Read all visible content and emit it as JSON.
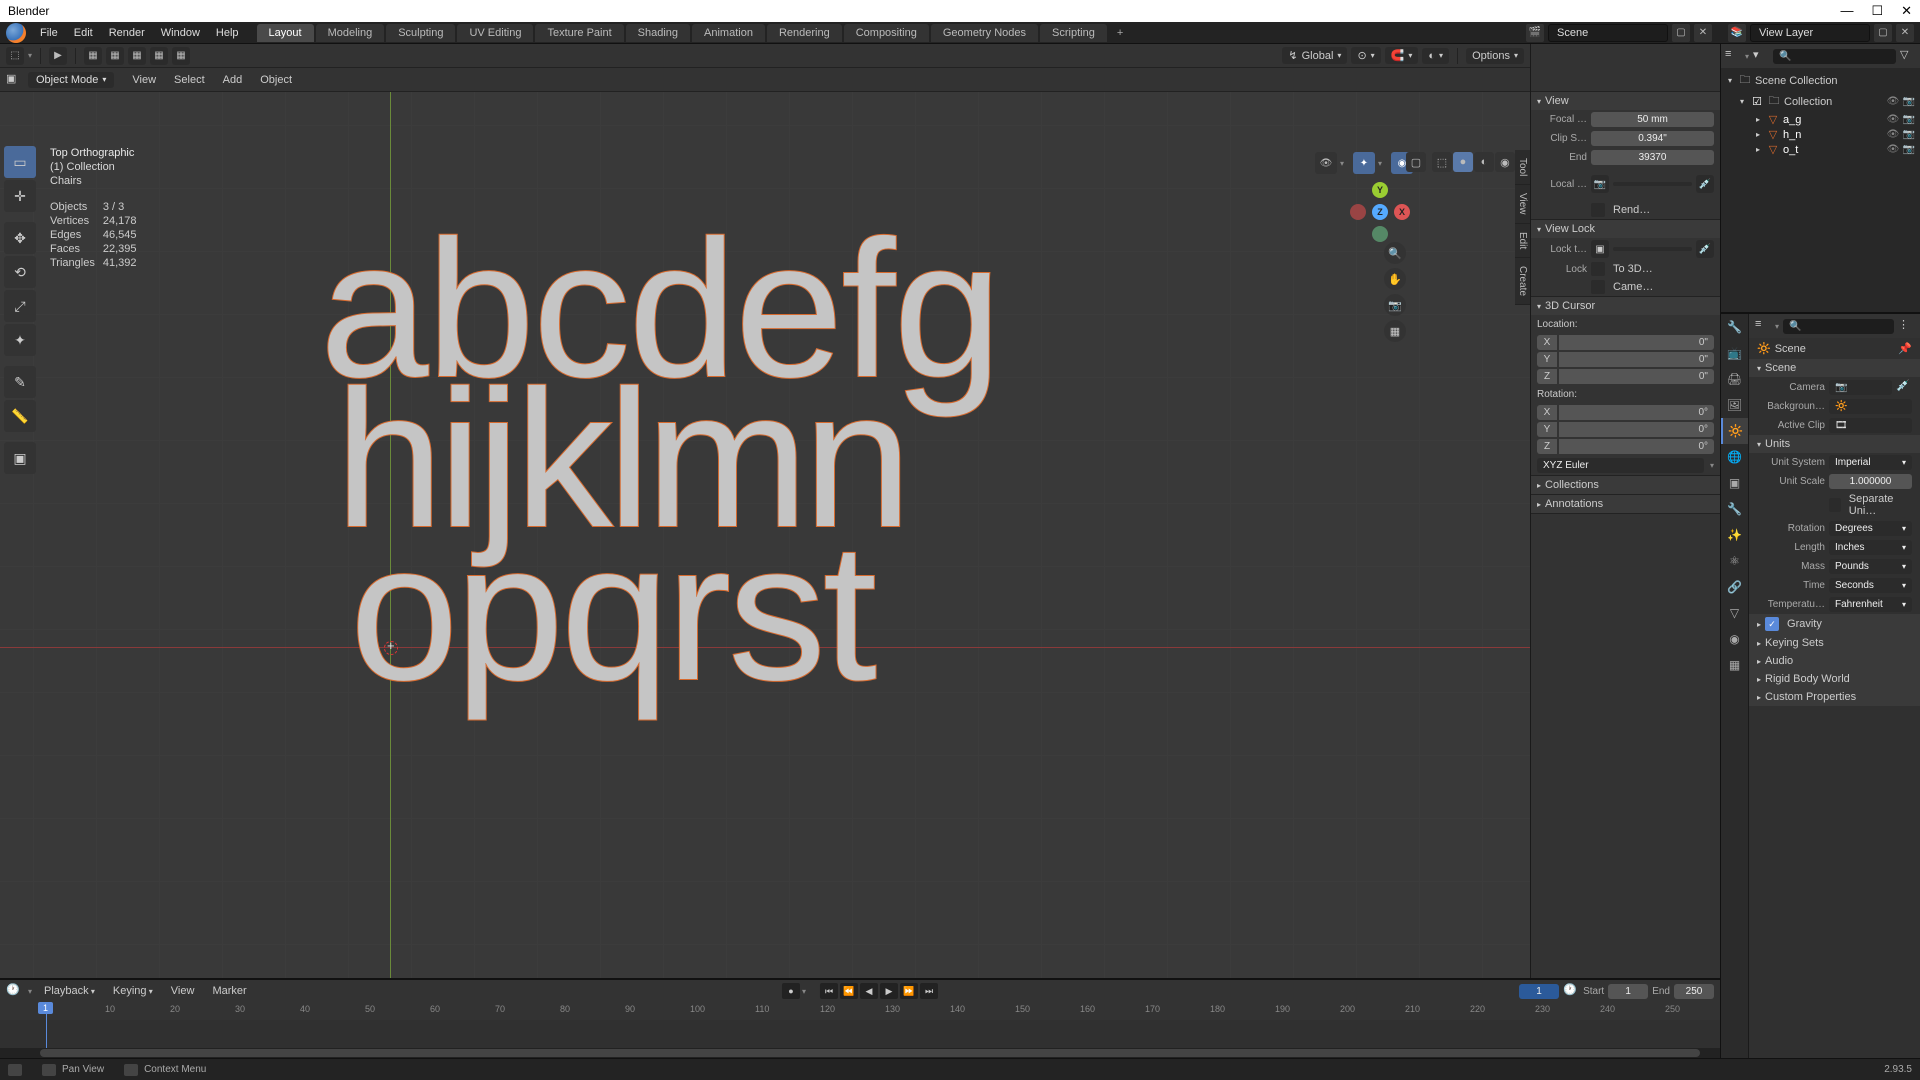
{
  "app": {
    "title": "Blender"
  },
  "menu": {
    "file": "File",
    "edit": "Edit",
    "render": "Render",
    "window": "Window",
    "help": "Help"
  },
  "workspaces": [
    "Layout",
    "Modeling",
    "Sculpting",
    "UV Editing",
    "Texture Paint",
    "Shading",
    "Animation",
    "Rendering",
    "Compositing",
    "Geometry Nodes",
    "Scripting"
  ],
  "active_workspace": "Layout",
  "scene_label": "Scene",
  "viewlayer_label": "View Layer",
  "vp_header": {
    "cursor_icon_tip": "Editor Type",
    "mode": "Object Mode",
    "view": "View",
    "select": "Select",
    "add": "Add",
    "object": "Object",
    "orientation": "Global",
    "options": "Options"
  },
  "vp_info": {
    "title": "Top Orthographic",
    "subtitle": "(1) Collection",
    "object_name": "Chairs",
    "stats": [
      {
        "k": "Objects",
        "v": "3 / 3"
      },
      {
        "k": "Vertices",
        "v": "24,178"
      },
      {
        "k": "Edges",
        "v": "46,545"
      },
      {
        "k": "Faces",
        "v": "22,395"
      },
      {
        "k": "Triangles",
        "v": "41,392"
      }
    ]
  },
  "text3d": {
    "row1": "abcdefg",
    "row2": "hijklmn",
    "row3": "opqrst"
  },
  "npanel": {
    "view": {
      "title": "View",
      "focal_lbl": "Focal …",
      "focal": "50 mm",
      "clip_start_lbl": "Clip S…",
      "clip_start": "0.394\"",
      "clip_end_lbl": "End",
      "clip_end": "39370",
      "local_cam_lbl": "Local …",
      "render_region_lbl": "Rend…"
    },
    "viewlock": {
      "title": "View Lock",
      "lock_to_lbl": "Lock t…",
      "lock_lbl": "Lock",
      "lock_val": "To 3D…",
      "camera_lbl": "Came…"
    },
    "cursor": {
      "title": "3D Cursor",
      "location": "Location:",
      "rotation": "Rotation:",
      "loc": {
        "x": "0\"",
        "y": "0\"",
        "z": "0\""
      },
      "rot": {
        "x": "0°",
        "y": "0°",
        "z": "0°"
      },
      "rotmode": "XYZ Euler"
    },
    "collections": "Collections",
    "annotations": "Annotations",
    "side_tabs": [
      "Tool",
      "View",
      "Edit",
      "Create"
    ]
  },
  "outliner": {
    "search_placeholder": "",
    "root": "Scene Collection",
    "collection": "Collection",
    "items": [
      "a_g",
      "h_n",
      "o_t"
    ]
  },
  "props": {
    "search_placeholder": "",
    "crumb_scene": "Scene",
    "scene_header": "Scene",
    "camera_lbl": "Camera",
    "background_lbl": "Backgroun…",
    "active_clip_lbl": "Active Clip",
    "units_header": "Units",
    "unit_system_lbl": "Unit System",
    "unit_system": "Imperial",
    "unit_scale_lbl": "Unit Scale",
    "unit_scale": "1.000000",
    "separate_lbl": "Separate Uni…",
    "rotation_lbl": "Rotation",
    "rotation": "Degrees",
    "length_lbl": "Length",
    "length": "Inches",
    "mass_lbl": "Mass",
    "mass": "Pounds",
    "time_lbl": "Time",
    "time": "Seconds",
    "temperature_lbl": "Temperatu…",
    "temperature": "Fahrenheit",
    "gravity": "Gravity",
    "keying_sets": "Keying Sets",
    "audio": "Audio",
    "rigid_body": "Rigid Body World",
    "custom_props": "Custom Properties"
  },
  "timeline": {
    "playback": "Playback",
    "keying": "Keying",
    "view": "View",
    "marker": "Marker",
    "current": "1",
    "start_lbl": "Start",
    "start": "1",
    "end_lbl": "End",
    "end": "250",
    "ticks": [
      10,
      20,
      30,
      40,
      50,
      60,
      70,
      80,
      90,
      100,
      110,
      120,
      130,
      140,
      150,
      160,
      170,
      180,
      190,
      200,
      210,
      220,
      230,
      240,
      250
    ]
  },
  "status": {
    "pan": "Pan View",
    "context": "Context Menu",
    "version": "2.93.5"
  }
}
